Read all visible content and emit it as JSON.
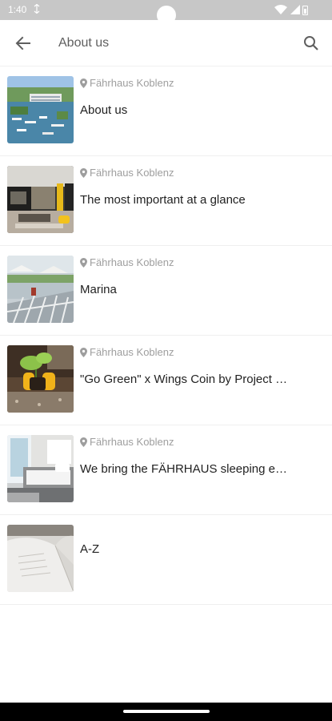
{
  "status_bar": {
    "time": "1:40",
    "sync_icon": "sync-icon",
    "wifi_icon": "wifi-icon",
    "signal_icon": "signal-icon",
    "battery_icon": "battery-icon"
  },
  "app_bar": {
    "title": "About us",
    "back_icon": "arrow-back-icon",
    "search_icon": "search-icon"
  },
  "items": [
    {
      "location": "Fährhaus Koblenz",
      "title": "About us",
      "thumb": "harbor-aerial"
    },
    {
      "location": "Fährhaus Koblenz",
      "title": "The most important at a glance",
      "thumb": "lounge-interior"
    },
    {
      "location": "Fährhaus Koblenz",
      "title": "Marina",
      "thumb": "marina-terrace"
    },
    {
      "location": "Fährhaus Koblenz",
      "title": "\"Go Green\" x Wings Coin by Project …",
      "thumb": "planting-hands"
    },
    {
      "location": "Fährhaus Koblenz",
      "title": "We bring the FÄHRHAUS sleeping e…",
      "thumb": "hotel-bedroom"
    },
    {
      "location": "",
      "title": "A-Z",
      "thumb": "open-book"
    }
  ],
  "colors": {
    "status_bar": "#c7c7c7",
    "text_primary": "#222222",
    "text_secondary": "#9e9e9e",
    "app_title": "#5f5f5f"
  }
}
